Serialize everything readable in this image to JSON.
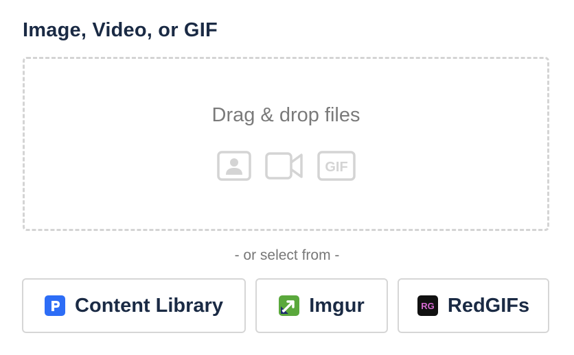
{
  "section": {
    "title": "Image, Video, or GIF"
  },
  "dropzone": {
    "prompt": "Drag & drop files",
    "icons": [
      "image-icon",
      "video-icon",
      "gif-icon"
    ],
    "gif_badge": "GIF"
  },
  "divider": {
    "text": "- or select from -"
  },
  "sources": [
    {
      "label": "Content Library",
      "icon": "content-library-icon",
      "color": "#2d6df6"
    },
    {
      "label": "Imgur",
      "icon": "imgur-icon",
      "color": "#5aa83c"
    },
    {
      "label": "RedGIFs",
      "icon": "redgifs-icon",
      "color": "#111111",
      "badge": "RG"
    }
  ],
  "colors": {
    "text_dark": "#1a2a44",
    "muted": "#777777",
    "border": "#d6d6d6"
  }
}
